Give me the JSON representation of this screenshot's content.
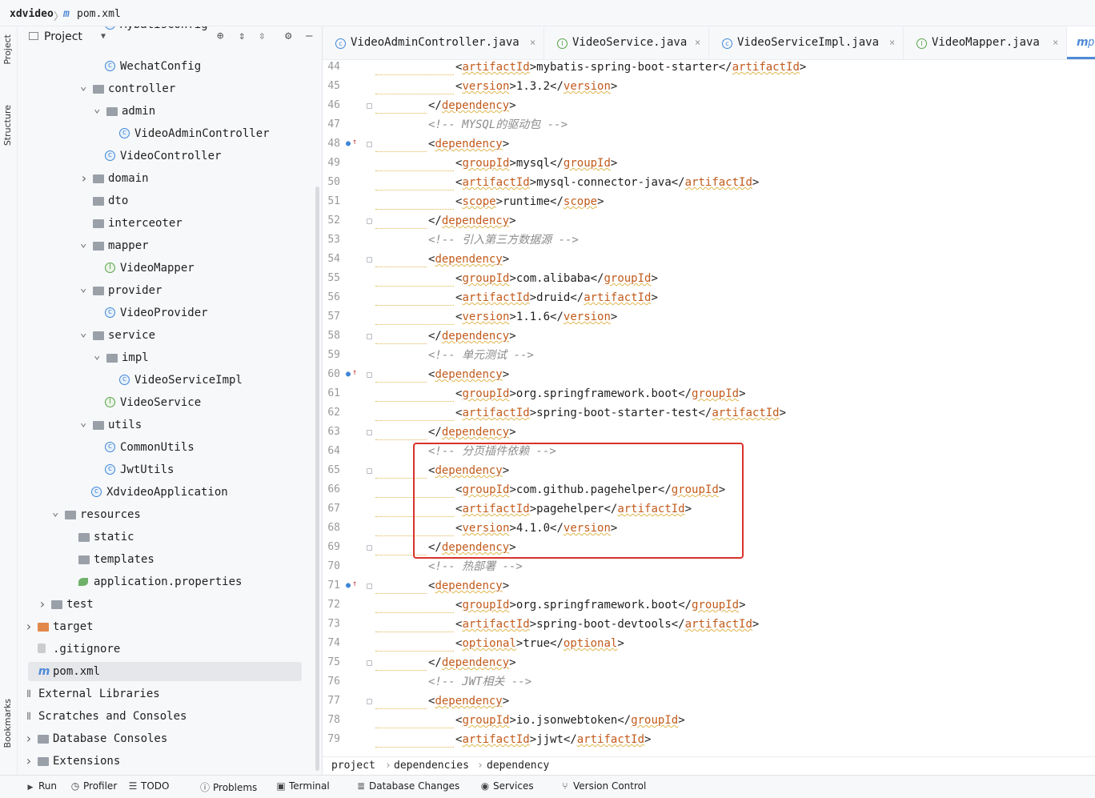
{
  "breadcrumb": {
    "project": "xdvideo",
    "file": "pom.xml"
  },
  "left_strip": {
    "project_label": "Project",
    "structure_label": "Structure",
    "bookmarks_label": "Bookmarks"
  },
  "project_panel": {
    "title": "Project",
    "items": [
      {
        "label": "MybatisConfig",
        "icon": "class"
      },
      {
        "label": "WechatConfig",
        "icon": "class"
      },
      {
        "label": "controller",
        "icon": "folder",
        "arrow": "v"
      },
      {
        "label": "admin",
        "icon": "folder",
        "arrow": "v"
      },
      {
        "label": "VideoAdminController",
        "icon": "class"
      },
      {
        "label": "VideoController",
        "icon": "class"
      },
      {
        "label": "domain",
        "icon": "folder",
        "arrow": ">"
      },
      {
        "label": "dto",
        "icon": "folder"
      },
      {
        "label": "interceoter",
        "icon": "folder"
      },
      {
        "label": "mapper",
        "icon": "folder",
        "arrow": "v"
      },
      {
        "label": "VideoMapper",
        "icon": "iface"
      },
      {
        "label": "provider",
        "icon": "folder",
        "arrow": "v"
      },
      {
        "label": "VideoProvider",
        "icon": "class"
      },
      {
        "label": "service",
        "icon": "folder",
        "arrow": "v"
      },
      {
        "label": "impl",
        "icon": "folder",
        "arrow": "v"
      },
      {
        "label": "VideoServiceImpl",
        "icon": "class"
      },
      {
        "label": "VideoService",
        "icon": "iface"
      },
      {
        "label": "utils",
        "icon": "folder",
        "arrow": "v"
      },
      {
        "label": "CommonUtils",
        "icon": "class"
      },
      {
        "label": "JwtUtils",
        "icon": "class"
      },
      {
        "label": "XdvideoApplication",
        "icon": "class"
      },
      {
        "label": "resources",
        "icon": "folder",
        "arrow": "v"
      },
      {
        "label": "static",
        "icon": "folder"
      },
      {
        "label": "templates",
        "icon": "folder"
      },
      {
        "label": "application.properties",
        "icon": "leaf"
      },
      {
        "label": "test",
        "icon": "folder",
        "arrow": ">"
      },
      {
        "label": "target",
        "icon": "folder-o",
        "arrow": ">"
      },
      {
        "label": ".gitignore",
        "icon": "gen"
      },
      {
        "label": "pom.xml",
        "icon": "maven"
      },
      {
        "label": "External Libraries",
        "icon": "lib",
        "arrow": ">"
      },
      {
        "label": "Scratches and Consoles",
        "icon": "lib",
        "arrow": "v"
      },
      {
        "label": "Database Consoles",
        "icon": "folder",
        "arrow": ">"
      },
      {
        "label": "Extensions",
        "icon": "folder",
        "arrow": ">"
      }
    ]
  },
  "tabs": [
    {
      "label": "VideoAdminController.java",
      "icon": "C"
    },
    {
      "label": "VideoService.java",
      "icon": "I"
    },
    {
      "label": "VideoServiceImpl.java",
      "icon": "C"
    },
    {
      "label": "VideoMapper.java",
      "icon": "I"
    },
    {
      "label": "p",
      "icon": "m"
    }
  ],
  "editor": {
    "lines": [
      {
        "n": "44",
        "indent": 2,
        "kind": "el",
        "tag": "artifactId",
        "text": "mybatis-spring-boot-starter"
      },
      {
        "n": "45",
        "indent": 2,
        "kind": "el",
        "tag": "version",
        "text": "1.3.2"
      },
      {
        "n": "46",
        "indent": 1,
        "kind": "close",
        "tag": "dependency"
      },
      {
        "n": "47",
        "indent": 1,
        "kind": "comment",
        "text": "<!-- MYSQL的驱动包 -->"
      },
      {
        "n": "48",
        "indent": 1,
        "kind": "open",
        "tag": "dependency"
      },
      {
        "n": "49",
        "indent": 2,
        "kind": "el",
        "tag": "groupId",
        "text": "mysql"
      },
      {
        "n": "50",
        "indent": 2,
        "kind": "el",
        "tag": "artifactId",
        "text": "mysql-connector-java"
      },
      {
        "n": "51",
        "indent": 2,
        "kind": "el",
        "tag": "scope",
        "text": "runtime"
      },
      {
        "n": "52",
        "indent": 1,
        "kind": "close",
        "tag": "dependency"
      },
      {
        "n": "53",
        "indent": 1,
        "kind": "comment",
        "text": "<!-- 引入第三方数据源 -->"
      },
      {
        "n": "54",
        "indent": 1,
        "kind": "open",
        "tag": "dependency"
      },
      {
        "n": "55",
        "indent": 2,
        "kind": "el",
        "tag": "groupId",
        "text": "com.alibaba"
      },
      {
        "n": "56",
        "indent": 2,
        "kind": "el",
        "tag": "artifactId",
        "text": "druid"
      },
      {
        "n": "57",
        "indent": 2,
        "kind": "el",
        "tag": "version",
        "text": "1.1.6"
      },
      {
        "n": "58",
        "indent": 1,
        "kind": "close",
        "tag": "dependency"
      },
      {
        "n": "59",
        "indent": 1,
        "kind": "comment",
        "text": "<!-- 单元测试 -->"
      },
      {
        "n": "60",
        "indent": 1,
        "kind": "open",
        "tag": "dependency"
      },
      {
        "n": "61",
        "indent": 2,
        "kind": "el",
        "tag": "groupId",
        "text": "org.springframework.boot"
      },
      {
        "n": "62",
        "indent": 2,
        "kind": "el",
        "tag": "artifactId",
        "text": "spring-boot-starter-test"
      },
      {
        "n": "63",
        "indent": 1,
        "kind": "close",
        "tag": "dependency"
      },
      {
        "n": "64",
        "indent": 1,
        "kind": "comment",
        "text": "<!-- 分页插件依赖 -->"
      },
      {
        "n": "65",
        "indent": 1,
        "kind": "open",
        "tag": "dependency"
      },
      {
        "n": "66",
        "indent": 2,
        "kind": "el",
        "tag": "groupId",
        "text": "com.github.pagehelper"
      },
      {
        "n": "67",
        "indent": 2,
        "kind": "el",
        "tag": "artifactId",
        "text": "pagehelper"
      },
      {
        "n": "68",
        "indent": 2,
        "kind": "el",
        "tag": "version",
        "text": "4.1.0"
      },
      {
        "n": "69",
        "indent": 1,
        "kind": "close",
        "tag": "dependency"
      },
      {
        "n": "70",
        "indent": 1,
        "kind": "comment",
        "text": "<!-- 热部署 -->"
      },
      {
        "n": "71",
        "indent": 1,
        "kind": "open",
        "tag": "dependency"
      },
      {
        "n": "72",
        "indent": 2,
        "kind": "el",
        "tag": "groupId",
        "text": "org.springframework.boot"
      },
      {
        "n": "73",
        "indent": 2,
        "kind": "el",
        "tag": "artifactId",
        "text": "spring-boot-devtools"
      },
      {
        "n": "74",
        "indent": 2,
        "kind": "el",
        "tag": "optional",
        "text": "true"
      },
      {
        "n": "75",
        "indent": 1,
        "kind": "close",
        "tag": "dependency"
      },
      {
        "n": "76",
        "indent": 1,
        "kind": "comment",
        "text": "<!-- JWT相关 -->"
      },
      {
        "n": "77",
        "indent": 1,
        "kind": "open",
        "tag": "dependency"
      },
      {
        "n": "78",
        "indent": 2,
        "kind": "el",
        "tag": "groupId",
        "text": "io.jsonwebtoken"
      },
      {
        "n": "79",
        "indent": 2,
        "kind": "el",
        "tag": "artifactId",
        "text": "jjwt"
      }
    ]
  },
  "editor_breadcrumb": [
    "project",
    "dependencies",
    "dependency"
  ],
  "toolbar": [
    {
      "label": "Run",
      "icon": "play-icon"
    },
    {
      "label": "Profiler",
      "icon": "profiler-icon"
    },
    {
      "label": "TODO",
      "icon": "list-icon"
    },
    {
      "label": "Problems",
      "icon": "info-icon"
    },
    {
      "label": "Terminal",
      "icon": "terminal-icon"
    },
    {
      "label": "Database Changes",
      "icon": "database-icon"
    },
    {
      "label": "Services",
      "icon": "services-icon"
    },
    {
      "label": "Version Control",
      "icon": "branch-icon"
    }
  ],
  "colors": {
    "tag_name": "#c25a1b",
    "comment": "#8c8c8c",
    "highlight_box": "#d8322a",
    "accent": "#4f8ad6"
  }
}
